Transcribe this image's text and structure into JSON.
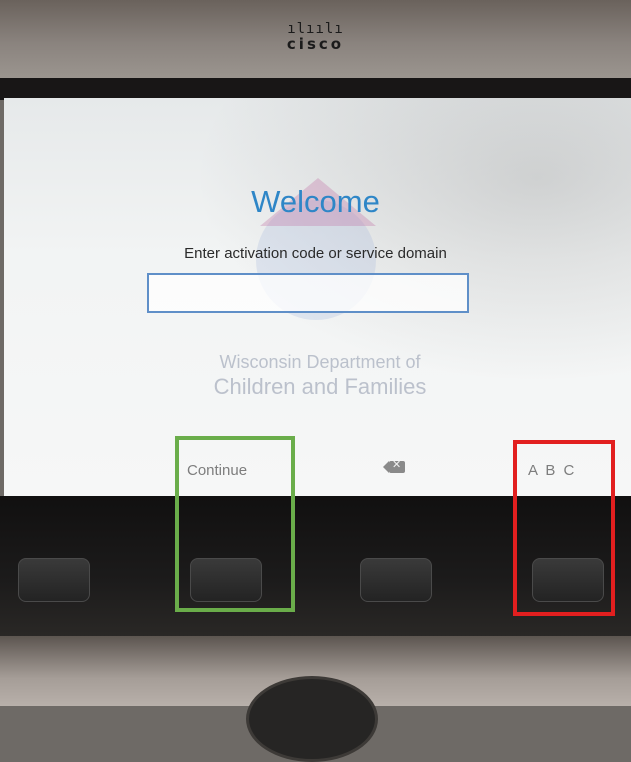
{
  "header": {
    "logo_bars": "ılıılı",
    "logo_text": "cisco"
  },
  "screen": {
    "welcome_title": "Welcome",
    "prompt": "Enter activation code or service domain",
    "input": {
      "value": "",
      "placeholder": ""
    },
    "watermark": {
      "line1": "Wisconsin Department of",
      "line2": "Children and Families"
    }
  },
  "softkeys": {
    "continue_label": "Continue",
    "backspace_icon": "backspace-icon",
    "abc_label": "A B C"
  },
  "colors": {
    "welcome": "#2e86c7",
    "input_border": "#5f8fc8",
    "highlight_green": "#6aad4a",
    "highlight_red": "#e21f1f"
  }
}
